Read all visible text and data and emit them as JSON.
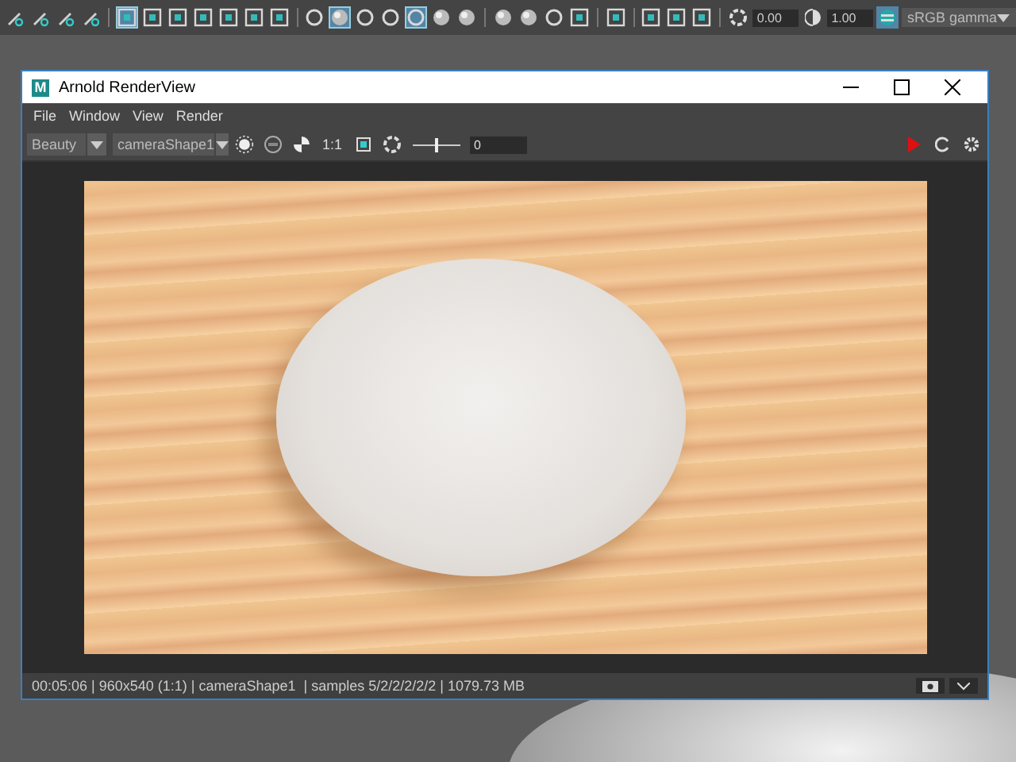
{
  "shelf": {
    "groups": [
      [
        {
          "kind": "tool",
          "selected": false
        },
        {
          "kind": "tool",
          "selected": false
        },
        {
          "kind": "tool",
          "selected": false
        },
        {
          "kind": "tool",
          "selected": false
        }
      ],
      [
        {
          "kind": "square",
          "selected": true
        },
        {
          "kind": "square",
          "selected": false
        },
        {
          "kind": "square",
          "selected": false
        },
        {
          "kind": "square",
          "selected": false
        },
        {
          "kind": "square",
          "selected": false
        },
        {
          "kind": "square",
          "selected": false
        },
        {
          "kind": "square",
          "selected": false
        }
      ],
      [
        {
          "kind": "circle",
          "selected": false
        },
        {
          "kind": "sphere",
          "selected": true
        },
        {
          "kind": "circle",
          "selected": false
        },
        {
          "kind": "circle",
          "selected": false
        },
        {
          "kind": "circle",
          "selected": true
        },
        {
          "kind": "sphere",
          "selected": false
        },
        {
          "kind": "sphere",
          "selected": false
        }
      ],
      [
        {
          "kind": "sphere",
          "selected": false
        },
        {
          "kind": "sphere",
          "selected": false
        },
        {
          "kind": "circle",
          "selected": false
        },
        {
          "kind": "square",
          "selected": false
        }
      ],
      [
        {
          "kind": "square",
          "selected": false
        }
      ],
      [
        {
          "kind": "square",
          "selected": false
        },
        {
          "kind": "square",
          "selected": false
        },
        {
          "kind": "square",
          "selected": false
        }
      ]
    ],
    "gain": "0.00",
    "gamma": "1.00",
    "color_space": "sRGB gamma"
  },
  "window": {
    "logo": "M",
    "title": "Arnold RenderView",
    "menu": [
      "File",
      "Window",
      "View",
      "Render"
    ],
    "toolbar": {
      "aov": "Beauty",
      "camera": "cameraShape1",
      "ratio": "1:1",
      "exposure": {
        "level": 0.5,
        "value": "0"
      }
    },
    "status_bar": "00:05:06 | 960x540 (1:1) | cameraShape1  | samples 5/2/2/2/2/2 | 1079.73 MB"
  }
}
